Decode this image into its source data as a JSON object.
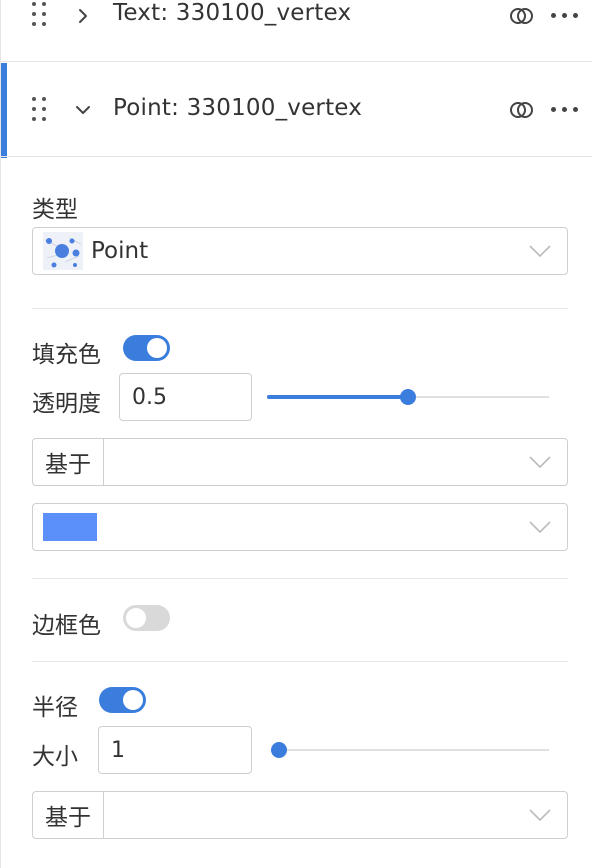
{
  "layers": [
    {
      "title": "Text: 330100_vertex",
      "expanded": false,
      "active": false
    },
    {
      "title": "Point: 330100_vertex",
      "expanded": true,
      "active": true
    }
  ],
  "props": {
    "type_label": "类型",
    "type_value": "Point",
    "type_icon": "point-layer-thumbnail-icon",
    "fill": {
      "label": "填充色",
      "enabled": true,
      "opacity_label": "透明度",
      "opacity_value": "0.5",
      "opacity_fraction": 0.5,
      "based_on_label": "基于",
      "based_on_value": "",
      "color": "#5b8ff9"
    },
    "border": {
      "label": "边框色",
      "enabled": false
    },
    "radius": {
      "label": "半径",
      "enabled": true,
      "size_label": "大小",
      "size_value": "1",
      "size_fraction": 0.0,
      "based_on_label": "基于",
      "based_on_value": ""
    }
  },
  "colors": {
    "accent": "#3b7ddd",
    "swatch": "#5b8ff9"
  }
}
